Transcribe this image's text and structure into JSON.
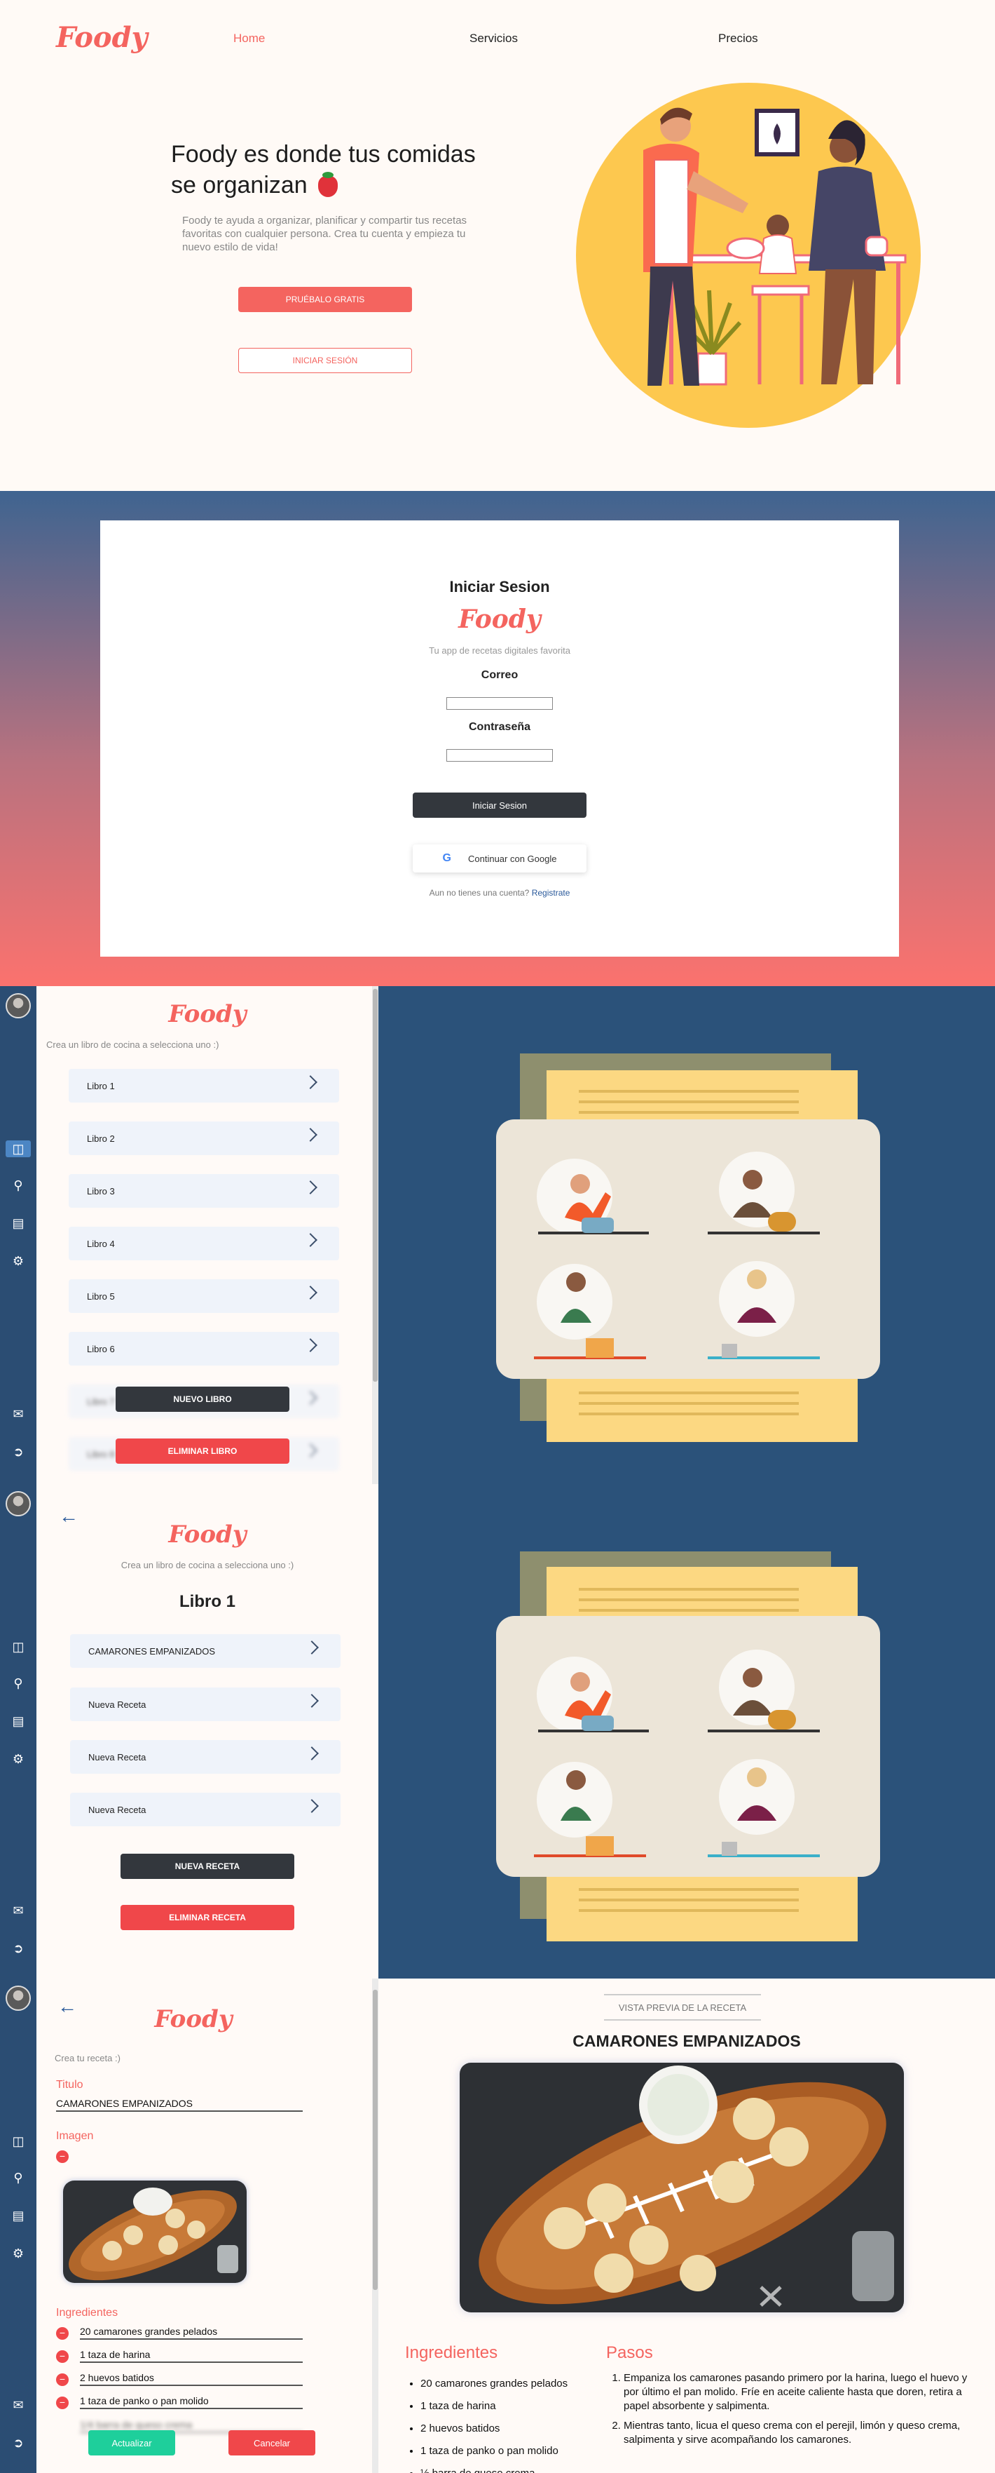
{
  "hero": {
    "logo": "Foody",
    "nav": [
      "Home",
      "Servicios",
      "Precios"
    ],
    "title": "Foody es donde tus comidas se organizan",
    "lead": "Foody te ayuda a organizar, planificar y compartir tus recetas favoritas con cualquier persona. Crea tu cuenta y empieza tu nuevo estilo de vida!",
    "try_button": "PRUÉBALO GRATIS",
    "login_button": "INICIAR SESIÓN"
  },
  "login": {
    "title": "Iniciar Sesion",
    "brand": "Foody",
    "subtitle": "Tu app de recetas digitales favorita",
    "email_label": "Correo",
    "password_label": "Contraseña",
    "email_value": "",
    "password_value": "",
    "submit": "Iniciar Sesion",
    "google": "Continuar con Google",
    "register_prompt": "Aun no tienes una cuenta?",
    "register_link": "Registrate"
  },
  "books_screen": {
    "brand": "Foody",
    "hint": "Crea un libro de cocina a selecciona uno :)",
    "books": [
      "Libro 1",
      "Libro 2",
      "Libro 3",
      "Libro 4",
      "Libro 5",
      "Libro 6",
      "Libro 7",
      "Libro 8"
    ],
    "new_button": "NUEVO LIBRO",
    "delete_button": "ELIMINAR LIBRO"
  },
  "book_detail": {
    "brand": "Foody",
    "hint": "Crea un libro de cocina a selecciona uno :)",
    "title": "Libro 1",
    "recipes": [
      "CAMARONES EMPANIZADOS",
      "Nueva Receta",
      "Nueva Receta",
      "Nueva Receta"
    ],
    "new_button": "NUEVA RECETA",
    "delete_button": "ELIMINAR RECETA"
  },
  "recipe_editor": {
    "brand": "Foody",
    "hint": "Crea tu receta :)",
    "title_label": "Titulo",
    "title_value": "CAMARONES EMPANIZADOS",
    "image_label": "Imagen",
    "ingredients_label": "Ingredientes",
    "ingredients": [
      "20 camarones grandes pelados",
      "1 taza de harina",
      "2 huevos batidos",
      "1 taza de panko o pan molido",
      "1/4 barra de queso crema"
    ],
    "update_button": "Actualizar",
    "cancel_button": "Cancelar"
  },
  "preview": {
    "tag": "VISTA PREVIA DE LA RECETA",
    "title": "CAMARONES EMPANIZADOS",
    "ingredients_title": "Ingredientes",
    "steps_title": "Pasos",
    "ingredients": [
      "20 camarones grandes pelados",
      "1 taza de harina",
      "2 huevos batidos",
      "1 taza de panko o pan molido",
      "½ barra de queso crema"
    ],
    "steps": [
      "Empaniza los camarones pasando primero por la harina, luego el huevo y por último el pan molido. Fríe en aceite caliente hasta que doren, retira a papel absorbente y salpimenta.",
      "Mientras tanto, licua el queso crema con el perejil, limón y queso crema, salpimenta y sirve acompañando los camarones."
    ]
  },
  "icons": {
    "sidebar": [
      "book-icon",
      "search-icon",
      "calendar-icon",
      "gear-icon",
      "chat-icon",
      "logout-icon"
    ]
  },
  "colors": {
    "accent": "#f4645f",
    "sidebar": "#2b4d73",
    "dark_button": "#33373d",
    "danger": "#f0474a",
    "success": "#1ecf9b"
  }
}
